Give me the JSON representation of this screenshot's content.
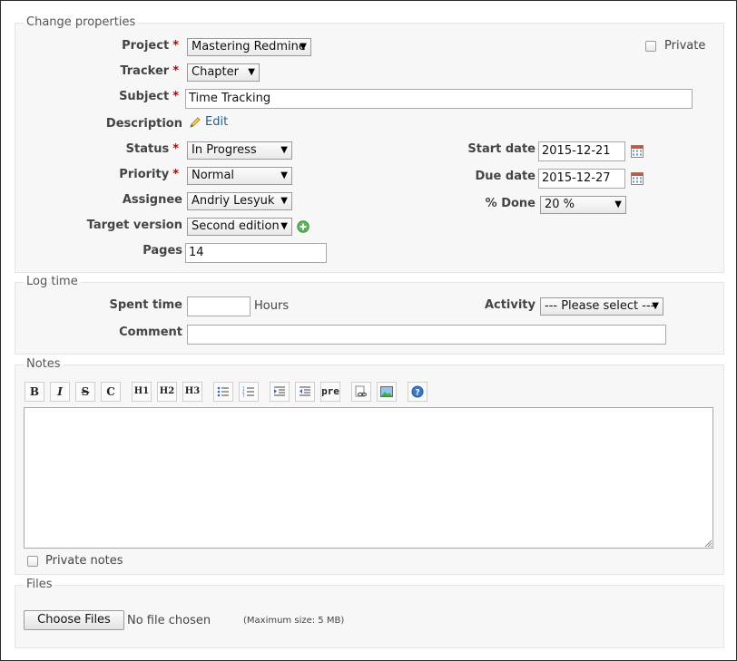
{
  "change_properties": {
    "legend": "Change properties",
    "project": {
      "label": "Project",
      "value": "Mastering Redmine"
    },
    "private": {
      "label": "Private",
      "checked": false
    },
    "tracker": {
      "label": "Tracker",
      "value": "Chapter"
    },
    "subject": {
      "label": "Subject",
      "value": "Time Tracking"
    },
    "description": {
      "label": "Description",
      "edit_label": "Edit"
    },
    "status": {
      "label": "Status",
      "value": "In Progress"
    },
    "priority": {
      "label": "Priority",
      "value": "Normal"
    },
    "assignee": {
      "label": "Assignee",
      "value": "Andriy Lesyuk"
    },
    "target_version": {
      "label": "Target version",
      "value": "Second edition"
    },
    "pages": {
      "label": "Pages",
      "value": "14"
    },
    "start_date": {
      "label": "Start date",
      "value": "2015-12-21"
    },
    "due_date": {
      "label": "Due date",
      "value": "2015-12-27"
    },
    "done": {
      "label": "% Done",
      "value": "20 %"
    },
    "required_marker": "*"
  },
  "log_time": {
    "legend": "Log time",
    "spent_time": {
      "label": "Spent time",
      "value": "",
      "unit": "Hours"
    },
    "activity": {
      "label": "Activity",
      "value": "--- Please select ---"
    },
    "comment": {
      "label": "Comment",
      "value": ""
    }
  },
  "notes": {
    "legend": "Notes",
    "toolbar": {
      "bold": "B",
      "italic": "I",
      "strike": "S",
      "code": "C",
      "h1": "H1",
      "h2": "H2",
      "h3": "H3",
      "pre": "pre"
    },
    "text": "",
    "private_notes": {
      "label": "Private notes",
      "checked": false
    }
  },
  "files": {
    "legend": "Files",
    "choose_button": "Choose Files",
    "no_file": "No file chosen",
    "max_size": "(Maximum size: 5 MB)"
  },
  "colors": {
    "required": "#bb0000",
    "link": "#2a5a8a",
    "fieldset_bg": "#f7f7f7"
  }
}
